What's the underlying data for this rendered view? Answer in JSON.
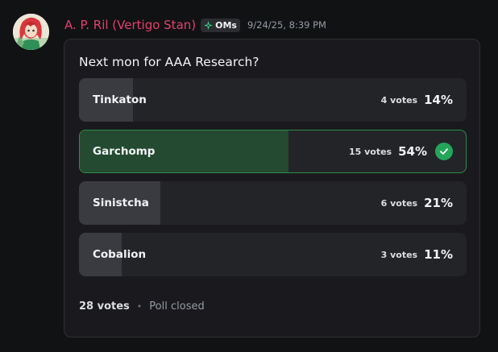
{
  "message": {
    "author": "A. P. Ril (Vertigo Stan)",
    "tag": {
      "label": "OMs",
      "icon": "sparkle-diamond-icon",
      "color": "#23a55a"
    },
    "timestamp": "9/24/25, 8:39 PM",
    "author_color": "#e5406d"
  },
  "poll": {
    "question": "Next mon for AAA Research?",
    "answers": [
      {
        "label": "Tinkaton",
        "votes": "4 votes",
        "percent": "14%",
        "fraction": 0.14,
        "winner": false
      },
      {
        "label": "Garchomp",
        "votes": "15 votes",
        "percent": "54%",
        "fraction": 0.54,
        "winner": true
      },
      {
        "label": "Sinistcha",
        "votes": "6 votes",
        "percent": "21%",
        "fraction": 0.21,
        "winner": false
      },
      {
        "label": "Cobalion",
        "votes": "3 votes",
        "percent": "11%",
        "fraction": 0.11,
        "winner": false
      }
    ],
    "total": "28 votes",
    "separator": "•",
    "status": "Poll closed",
    "winner_icon": "checkmark-icon"
  }
}
